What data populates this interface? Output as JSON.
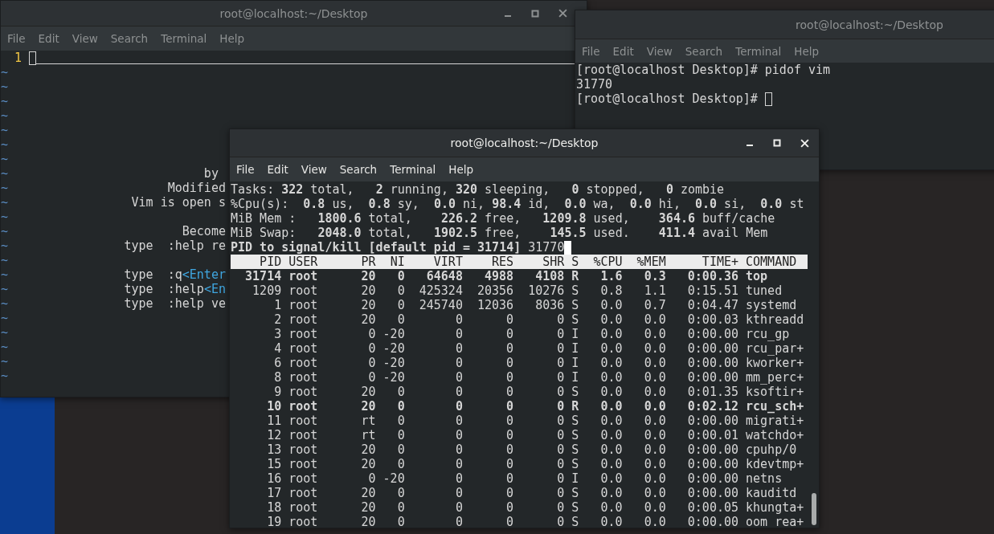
{
  "windows": [
    {
      "kind": "vim",
      "title": "root@localhost:~/Desktop",
      "focused": false,
      "menu": [
        "File",
        "Edit",
        "View",
        "Search",
        "Terminal",
        "Help"
      ],
      "vim": {
        "line_number": "1",
        "tilde_lines": [
          {
            "marker": "~"
          },
          {
            "marker": "~"
          },
          {
            "marker": "~"
          },
          {
            "marker": "~"
          },
          {
            "marker": "~"
          },
          {
            "marker": "~"
          },
          {
            "marker": "~"
          },
          {
            "marker": "~",
            "segments": [
              {
                "kind": "text",
                "text": "                           by"
              }
            ]
          },
          {
            "marker": "~",
            "segments": [
              {
                "kind": "text",
                "text": "                      Modified"
              }
            ]
          },
          {
            "marker": "~",
            "segments": [
              {
                "kind": "text",
                "text": "                 Vim is open s"
              }
            ]
          },
          {
            "marker": "~"
          },
          {
            "marker": "~",
            "segments": [
              {
                "kind": "text",
                "text": "                        Become"
              }
            ]
          },
          {
            "marker": "~",
            "segments": [
              {
                "kind": "text",
                "text": "                type  :help re"
              }
            ]
          },
          {
            "marker": "~"
          },
          {
            "marker": "~",
            "segments": [
              {
                "kind": "text",
                "text": "                type  :q"
              },
              {
                "kind": "key",
                "text": "<Enter"
              }
            ]
          },
          {
            "marker": "~",
            "segments": [
              {
                "kind": "text",
                "text": "                type  :help"
              },
              {
                "kind": "key",
                "text": "<En"
              }
            ]
          },
          {
            "marker": "~",
            "segments": [
              {
                "kind": "text",
                "text": "                type  :help ve"
              }
            ]
          },
          {
            "marker": "~"
          },
          {
            "marker": "~"
          },
          {
            "marker": "~"
          },
          {
            "marker": "~"
          },
          {
            "marker": "~"
          }
        ]
      }
    },
    {
      "kind": "shell",
      "title": "root@localhost:~/Desktop",
      "focused": false,
      "menu": [
        "File",
        "Edit",
        "View",
        "Search",
        "Terminal",
        "Help"
      ],
      "shell": {
        "lines": [
          "[root@localhost Desktop]# pidof vim",
          "31770",
          "[root@localhost Desktop]# "
        ]
      }
    },
    {
      "kind": "top",
      "title": "root@localhost:~/Desktop",
      "focused": true,
      "menu": [
        "File",
        "Edit",
        "View",
        "Search",
        "Terminal",
        "Help"
      ],
      "top": {
        "summary": [
          "Tasks: **322** total,   **2** running, **320** sleeping,   **0** stopped,   **0** zombie",
          "%Cpu(s):  **0.8** us,  **0.8** sy,  **0.0** ni, **98.4** id,  **0.0** wa,  **0.0** hi,  **0.0** si,  **0.0** st",
          "MiB Mem :   **1800.6** total,    **226.2** free,   **1209.8** used,    **364.6** buff/cache",
          "MiB Swap:   **2048.0** total,   **1902.5** free,    **145.5** used.    **411.4** avail Mem"
        ],
        "kill_prompt": {
          "label": "PID to signal/kill [default pid = 31714]",
          "value": "31770"
        },
        "columns": [
          "PID",
          "USER",
          "PR",
          "NI",
          "VIRT",
          "RES",
          "SHR",
          "S",
          "%CPU",
          "%MEM",
          "TIME+",
          "COMMAND"
        ],
        "rows": [
          {
            "emphasized": true,
            "cells": [
              "31714",
              "root",
              "20",
              "0",
              "64648",
              "4988",
              "4108",
              "R",
              "1.6",
              "0.3",
              "0:00.36",
              "top"
            ]
          },
          {
            "emphasized": false,
            "cells": [
              "1209",
              "root",
              "20",
              "0",
              "425324",
              "20356",
              "10276",
              "S",
              "0.8",
              "1.1",
              "0:15.51",
              "tuned"
            ]
          },
          {
            "emphasized": false,
            "cells": [
              "1",
              "root",
              "20",
              "0",
              "245740",
              "12036",
              "8036",
              "S",
              "0.0",
              "0.7",
              "0:04.47",
              "systemd"
            ]
          },
          {
            "emphasized": false,
            "cells": [
              "2",
              "root",
              "20",
              "0",
              "0",
              "0",
              "0",
              "S",
              "0.0",
              "0.0",
              "0:00.03",
              "kthreadd"
            ]
          },
          {
            "emphasized": false,
            "cells": [
              "3",
              "root",
              "0",
              "-20",
              "0",
              "0",
              "0",
              "I",
              "0.0",
              "0.0",
              "0:00.00",
              "rcu_gp"
            ]
          },
          {
            "emphasized": false,
            "cells": [
              "4",
              "root",
              "0",
              "-20",
              "0",
              "0",
              "0",
              "I",
              "0.0",
              "0.0",
              "0:00.00",
              "rcu_par+"
            ]
          },
          {
            "emphasized": false,
            "cells": [
              "6",
              "root",
              "0",
              "-20",
              "0",
              "0",
              "0",
              "I",
              "0.0",
              "0.0",
              "0:00.00",
              "kworker+"
            ]
          },
          {
            "emphasized": false,
            "cells": [
              "8",
              "root",
              "0",
              "-20",
              "0",
              "0",
              "0",
              "I",
              "0.0",
              "0.0",
              "0:00.00",
              "mm_perc+"
            ]
          },
          {
            "emphasized": false,
            "cells": [
              "9",
              "root",
              "20",
              "0",
              "0",
              "0",
              "0",
              "S",
              "0.0",
              "0.0",
              "0:01.35",
              "ksoftir+"
            ]
          },
          {
            "emphasized": true,
            "cells": [
              "10",
              "root",
              "20",
              "0",
              "0",
              "0",
              "0",
              "R",
              "0.0",
              "0.0",
              "0:02.12",
              "rcu_sch+"
            ]
          },
          {
            "emphasized": false,
            "cells": [
              "11",
              "root",
              "rt",
              "0",
              "0",
              "0",
              "0",
              "S",
              "0.0",
              "0.0",
              "0:00.00",
              "migrati+"
            ]
          },
          {
            "emphasized": false,
            "cells": [
              "12",
              "root",
              "rt",
              "0",
              "0",
              "0",
              "0",
              "S",
              "0.0",
              "0.0",
              "0:00.01",
              "watchdo+"
            ]
          },
          {
            "emphasized": false,
            "cells": [
              "13",
              "root",
              "20",
              "0",
              "0",
              "0",
              "0",
              "S",
              "0.0",
              "0.0",
              "0:00.00",
              "cpuhp/0"
            ]
          },
          {
            "emphasized": false,
            "cells": [
              "15",
              "root",
              "20",
              "0",
              "0",
              "0",
              "0",
              "S",
              "0.0",
              "0.0",
              "0:00.00",
              "kdevtmp+"
            ]
          },
          {
            "emphasized": false,
            "cells": [
              "16",
              "root",
              "0",
              "-20",
              "0",
              "0",
              "0",
              "I",
              "0.0",
              "0.0",
              "0:00.00",
              "netns"
            ]
          },
          {
            "emphasized": false,
            "cells": [
              "17",
              "root",
              "20",
              "0",
              "0",
              "0",
              "0",
              "S",
              "0.0",
              "0.0",
              "0:00.00",
              "kauditd"
            ]
          },
          {
            "emphasized": false,
            "cells": [
              "18",
              "root",
              "20",
              "0",
              "0",
              "0",
              "0",
              "S",
              "0.0",
              "0.0",
              "0:00.05",
              "khungta+"
            ]
          },
          {
            "emphasized": false,
            "cells": [
              "19",
              "root",
              "20",
              "0",
              "0",
              "0",
              "0",
              "S",
              "0.0",
              "0.0",
              "0:00.00",
              "oom_rea+"
            ]
          }
        ]
      }
    }
  ]
}
